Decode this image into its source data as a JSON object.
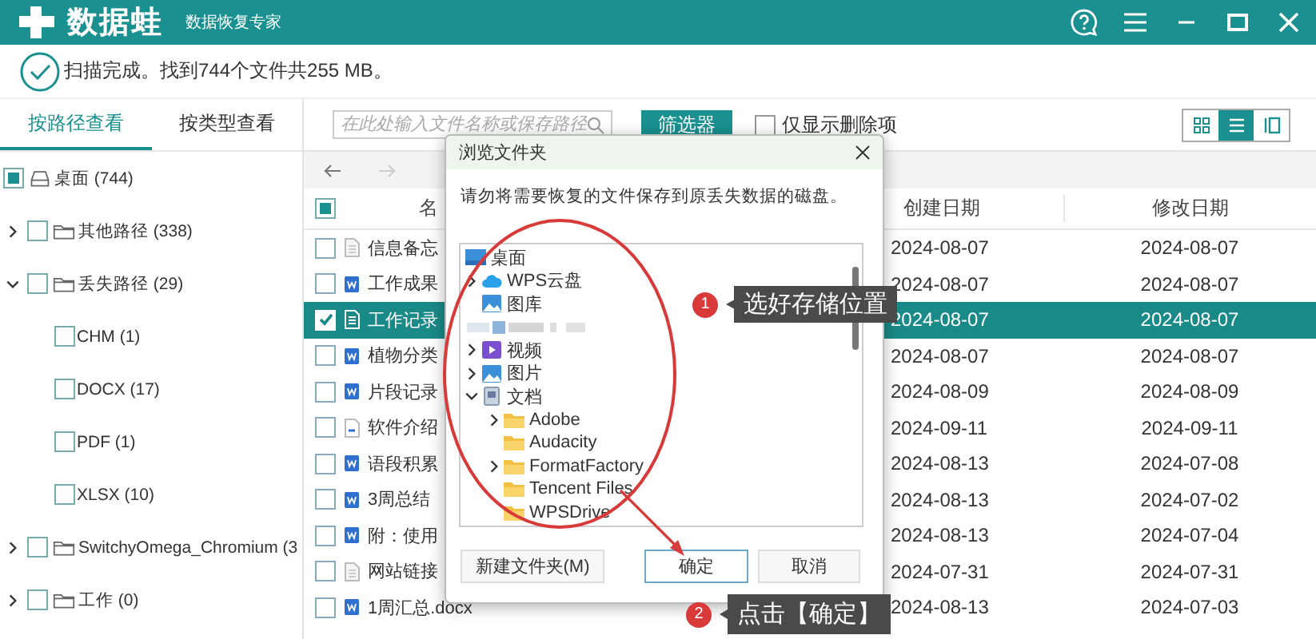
{
  "app": {
    "logo": "数据蛙",
    "subtitle": "数据恢复专家"
  },
  "scan_status": "扫描完成。找到744个文件共255 MB。",
  "view_tabs": [
    {
      "label": "按路径查看",
      "selected": true
    },
    {
      "label": "按类型查看",
      "selected": false
    }
  ],
  "path_tree": [
    {
      "label": "桌面 (744)",
      "kind": "drive",
      "checked": false,
      "partial": true,
      "children": [
        {
          "label": "其他路径 (338)",
          "kind": "folder",
          "checked": false,
          "partial": false,
          "expanded": false
        },
        {
          "label": "丢失路径 (29)",
          "kind": "folder",
          "checked": false,
          "partial": false,
          "expanded": true,
          "children": [
            {
              "label": "CHM (1)",
              "checked": false,
              "partial": false
            },
            {
              "label": "DOCX (17)",
              "checked": false,
              "partial": false
            },
            {
              "label": "PDF (1)",
              "checked": false,
              "partial": false
            },
            {
              "label": "XLSX (10)",
              "checked": false,
              "partial": false
            }
          ]
        },
        {
          "label": "SwitchyOmega_Chromium (3",
          "kind": "folder",
          "checked": false,
          "partial": false,
          "expanded": false
        },
        {
          "label": "工作 (0)",
          "kind": "folder",
          "checked": false,
          "partial": false,
          "expanded": false
        }
      ]
    }
  ],
  "search": {
    "placeholder": "在此处输入文件名称或保存路径"
  },
  "filter_button": "筛选器",
  "deleted_only": {
    "label": "仅显示删除项",
    "checked": false
  },
  "view_modes": [
    {
      "kind": "grid",
      "selected": false
    },
    {
      "kind": "list",
      "selected": true
    },
    {
      "kind": "detail",
      "selected": false
    }
  ],
  "nav": {
    "back_disabled": false,
    "forward_disabled": true
  },
  "table": {
    "header_checkbox": {
      "checked": false,
      "partial": true
    },
    "columns": [
      "名",
      "创建日期",
      "修改日期"
    ],
    "rows": [
      {
        "name": "信息备忘",
        "kind": "txt",
        "checked": false,
        "selected": false,
        "created": "2024-08-07",
        "modified": "2024-08-07"
      },
      {
        "name": "工作成果",
        "kind": "doc",
        "checked": false,
        "selected": false,
        "created": "2024-08-07",
        "modified": "2024-08-07"
      },
      {
        "name": "工作记录",
        "kind": "xls",
        "checked": true,
        "selected": true,
        "created": "2024-08-07",
        "modified": "2024-08-07"
      },
      {
        "name": "植物分类",
        "kind": "doc",
        "checked": false,
        "selected": false,
        "created": "2024-08-07",
        "modified": "2024-08-07"
      },
      {
        "name": "片段记录",
        "kind": "doc",
        "checked": false,
        "selected": false,
        "created": "2024-08-09",
        "modified": "2024-08-09"
      },
      {
        "name": "软件介绍",
        "kind": "other",
        "checked": false,
        "selected": false,
        "created": "2024-09-11",
        "modified": "2024-09-11"
      },
      {
        "name": "语段积累",
        "kind": "doc",
        "checked": false,
        "selected": false,
        "created": "2024-08-13",
        "modified": "2024-07-08"
      },
      {
        "name": "3周总结",
        "kind": "doc",
        "checked": false,
        "selected": false,
        "created": "2024-08-13",
        "modified": "2024-07-02"
      },
      {
        "name": "附：使用",
        "kind": "doc",
        "checked": false,
        "selected": false,
        "created": "2024-08-13",
        "modified": "2024-07-04"
      },
      {
        "name": "网站链接",
        "kind": "txt",
        "checked": false,
        "selected": false,
        "created": "2024-07-31",
        "modified": "2024-07-31"
      },
      {
        "name": "1周汇总.docx",
        "kind": "doc",
        "checked": false,
        "selected": false,
        "created": "2024-08-13",
        "modified": "2024-07-03"
      }
    ]
  },
  "dialog": {
    "title": "浏览文件夹",
    "message": "请勿将需要恢复的文件保存到原丢失数据的磁盘。",
    "tree": [
      {
        "label": "桌面",
        "kind": "desktop",
        "children": [
          {
            "label": "WPS云盘",
            "kind": "cloud",
            "expanded": false
          },
          {
            "label": "图库",
            "kind": "gallery"
          },
          {
            "kind": "blurred"
          },
          {
            "label": "视频",
            "kind": "video",
            "expanded": false
          },
          {
            "label": "图片",
            "kind": "pictures",
            "expanded": false
          },
          {
            "label": "文档",
            "kind": "documents",
            "expanded": true,
            "children": [
              {
                "label": "Adobe",
                "kind": "folder",
                "expanded": false
              },
              {
                "label": "Audacity",
                "kind": "folder"
              },
              {
                "label": "FormatFactory",
                "kind": "folder",
                "expanded": false
              },
              {
                "label": "Tencent Files",
                "kind": "folder"
              },
              {
                "label": "WPSDrive",
                "kind": "folder"
              }
            ]
          }
        ]
      }
    ],
    "buttons": [
      {
        "label": "新建文件夹(M)",
        "selected": false
      },
      {
        "label": "确定",
        "selected": true
      },
      {
        "label": "取消",
        "selected": false
      }
    ]
  },
  "annotations": [
    {
      "number": "1",
      "text": "选好存储位置"
    },
    {
      "number": "2",
      "text": "点击【确定】"
    }
  ]
}
